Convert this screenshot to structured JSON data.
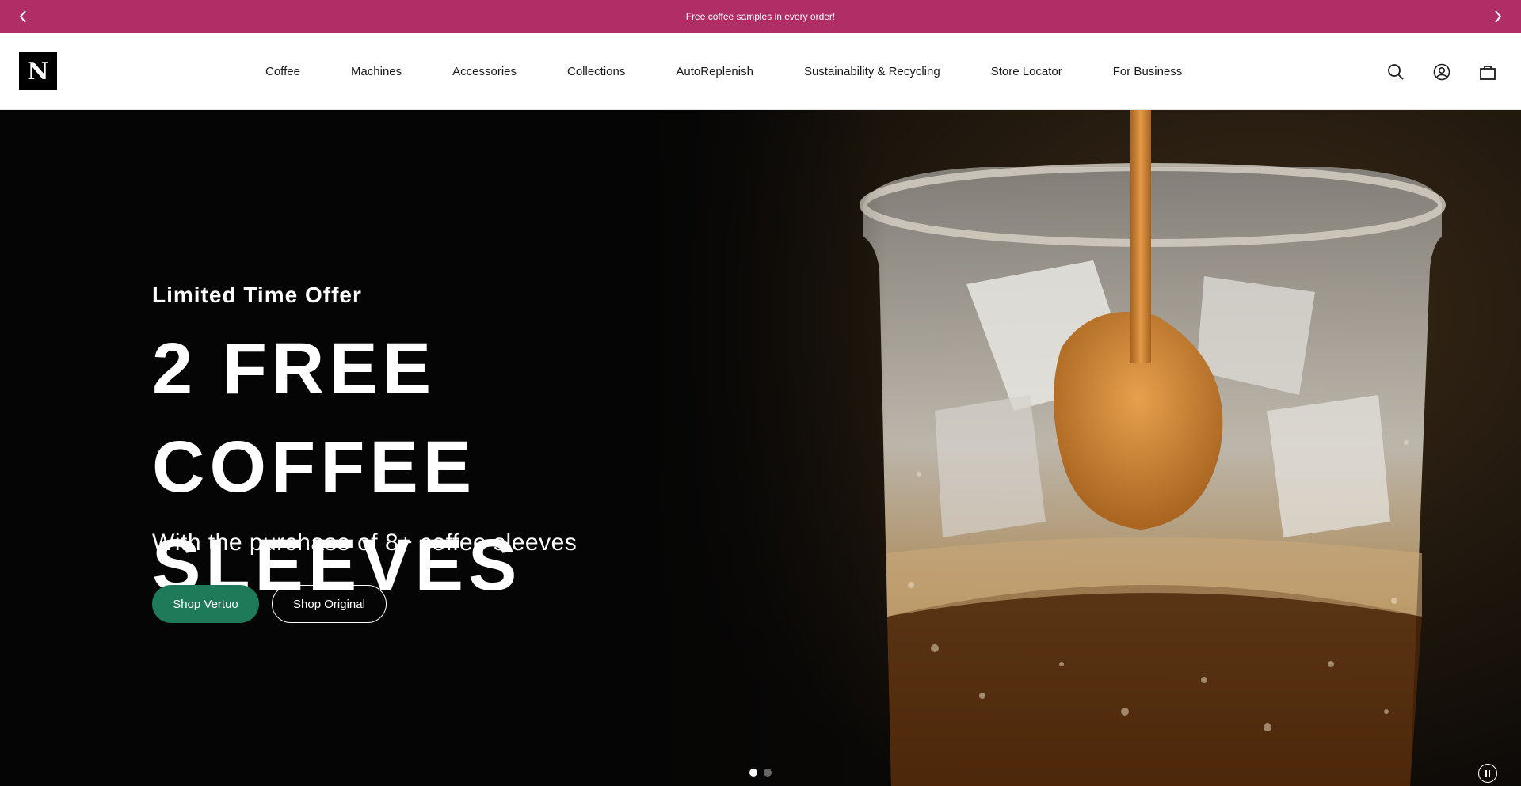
{
  "promo": {
    "text": "Free coffee samples in every order!",
    "prev_icon": "chevron-left-icon",
    "next_icon": "chevron-right-icon"
  },
  "header": {
    "logo_letter": "N",
    "nav": [
      {
        "label": "Coffee"
      },
      {
        "label": "Machines"
      },
      {
        "label": "Accessories"
      },
      {
        "label": "Collections"
      },
      {
        "label": "AutoReplenish"
      },
      {
        "label": "Sustainability & Recycling"
      },
      {
        "label": "Store Locator"
      },
      {
        "label": "For Business"
      }
    ],
    "icons": [
      "search-icon",
      "account-icon",
      "bag-icon"
    ]
  },
  "hero": {
    "eyebrow": "Limited Time Offer",
    "headline": "2 FREE COFFEE SLEEVES",
    "subline": "With the purchase of 8+ coffee sleeves",
    "cta_primary": "Shop Vertuo",
    "cta_secondary": "Shop Original",
    "slide_count": 2,
    "active_slide": 1
  },
  "colors": {
    "promo_bg": "#b02d66",
    "cta_primary_bg": "#1f7a5a",
    "hero_bg": "#050505"
  }
}
